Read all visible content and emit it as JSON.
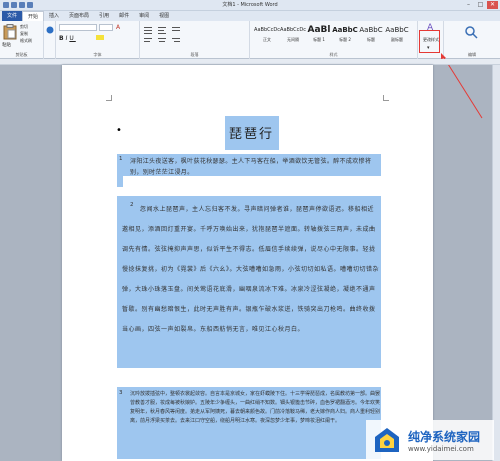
{
  "window": {
    "title": "文档1 - Microsoft Word"
  },
  "tabs": [
    "文件",
    "开始",
    "插入",
    "页面布局",
    "引用",
    "邮件",
    "审阅",
    "视图"
  ],
  "ribbon": {
    "groups": [
      "剪贴板",
      "字体",
      "段落",
      "样式",
      "编辑"
    ],
    "paste_label": "粘贴",
    "clip_items": [
      "剪切",
      "复制",
      "格式刷"
    ],
    "styles": [
      {
        "preview": "AaBbCcDc",
        "label": "正文"
      },
      {
        "preview": "AaBbCcDc",
        "label": "无间隔"
      },
      {
        "preview": "AaBl",
        "label": "标题 1"
      },
      {
        "preview": "AaBbC",
        "label": "标题 2"
      },
      {
        "preview": "AaBbC",
        "label": "标题"
      },
      {
        "preview": "AaBbC",
        "label": "副标题"
      }
    ],
    "change_styles": "更改样式",
    "edit_label": "编辑"
  },
  "doc": {
    "title": "琵琶行",
    "p1_num": "1",
    "p1": "浔阳江头夜送客，枫叶荻花秋瑟瑟。主人下马客在船，举酒欲饮无管弦。醉不成欢惨将别，别时茫茫江浸月。",
    "p2_num": "2",
    "p2": "忽闻水上琵琶声，主人忘归客不发。寻声暗问弹者谁，琵琶声停欲语迟。移船相近邀相见，添酒回灯重开宴。千呼万唤始出来，犹抱琵琶半遮面。转轴拨弦三两声，未成曲调先有情。弦弦掩抑声声思，似诉平生不得志。低眉信手续续弹，说尽心中无限事。轻拢慢捻抹复挑，初为《霓裳》后《六幺》。大弦嘈嘈如急雨，小弦切切如私语。嘈嘈切切错杂弹，大珠小珠落玉盘。间关莺语花底滑，幽咽泉流冰下难。冰泉冷涩弦凝绝，凝绝不通声暂歇。别有幽愁暗恨生，此时无声胜有声。银瓶乍破水浆迸，铁骑突出刀枪鸣。曲终收拨当心画，四弦一声如裂帛。东船西舫悄无言，唯见江心秋月白。",
    "p3_num": "3",
    "p3": "沉吟放拨插弦中，整顿衣裳起敛容。自言本是京城女，家在虾蟆陵下住。十三学得琵琶成，名属教坊第一部。曲罢曾教善才服，妆成每被秋娘妒。五陵年少争缠头，一曲红绡不知数。钿头银篦击节碎，血色罗裙翻酒污。今年欢笑复明年，秋月春风等闲度。弟走从军阿姨死，暮去朝来颜色故。门前冷落鞍马稀，老大嫁作商人妇。商人重利轻别离，前月浮梁买茶去。去来江口守空船，绕船月明江水寒。夜深忽梦少年事，梦啼妆泪红阑干。"
  },
  "watermark": {
    "title": "纯净系统家园",
    "url": "www.yidaimei.com"
  },
  "colors": {
    "selection": "#9ec6ef",
    "file_tab": "#2b5aa8",
    "highlight": "#e53935"
  }
}
